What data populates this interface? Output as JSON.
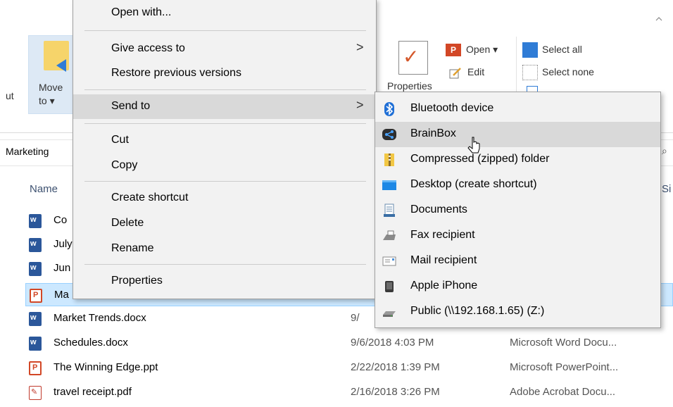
{
  "ribbon": {
    "cut_label": "ut",
    "move_to_label": "Move",
    "move_to_sub": "to ▾",
    "properties_label": "Properties",
    "open_label": "Open ▾",
    "open_icon_text": "P",
    "edit_label": "Edit",
    "select_all_label": "Select all",
    "select_none_label": "Select none"
  },
  "address": {
    "path": "Marketing"
  },
  "columns": {
    "name": "Name",
    "size": "Si"
  },
  "files": [
    {
      "name": "Co",
      "date": "",
      "type": "",
      "icon": "word-icon"
    },
    {
      "name": "July",
      "date": "",
      "type": "",
      "icon": "word-icon"
    },
    {
      "name": "Jun",
      "date": "",
      "type": "",
      "icon": "word-icon"
    },
    {
      "name": "Ma",
      "date": "",
      "type": "",
      "icon": "ppt-icon"
    },
    {
      "name": "Market Trends.docx",
      "date": "9/",
      "type": "",
      "icon": "word-icon"
    },
    {
      "name": "Schedules.docx",
      "date": "9/6/2018 4:03 PM",
      "type": "Microsoft Word Docu...",
      "icon": "word-icon"
    },
    {
      "name": "The Winning Edge.ppt",
      "date": "2/22/2018 1:39 PM",
      "type": "Microsoft PowerPoint...",
      "icon": "ppt-icon"
    },
    {
      "name": "travel receipt.pdf",
      "date": "2/16/2018 3:26 PM",
      "type": "Adobe Acrobat Docu...",
      "icon": "pdf-icon"
    }
  ],
  "context_menu": {
    "open_with": "Open with...",
    "give_access": "Give access to",
    "restore": "Restore previous versions",
    "send_to": "Send to",
    "cut": "Cut",
    "copy": "Copy",
    "create_shortcut": "Create shortcut",
    "delete": "Delete",
    "rename": "Rename",
    "properties": "Properties",
    "arrow": ">"
  },
  "send_to_menu": [
    {
      "label": "Bluetooth device",
      "icon": "bluetooth-icon"
    },
    {
      "label": "BrainBox",
      "icon": "brainbox-icon"
    },
    {
      "label": "Compressed (zipped) folder",
      "icon": "zip-folder-icon"
    },
    {
      "label": "Desktop (create shortcut)",
      "icon": "desktop-icon"
    },
    {
      "label": "Documents",
      "icon": "documents-icon"
    },
    {
      "label": "Fax recipient",
      "icon": "fax-icon"
    },
    {
      "label": "Mail recipient",
      "icon": "mail-icon"
    },
    {
      "label": "Apple iPhone",
      "icon": "phone-icon"
    },
    {
      "label": "Public (\\\\192.168.1.65) (Z:)",
      "icon": "network-drive-icon"
    }
  ],
  "colors": {
    "accent": "#2f7cd6",
    "selection": "#cce8ff",
    "menu_bg": "#f2f2f2",
    "hover": "#d9d9d9"
  }
}
